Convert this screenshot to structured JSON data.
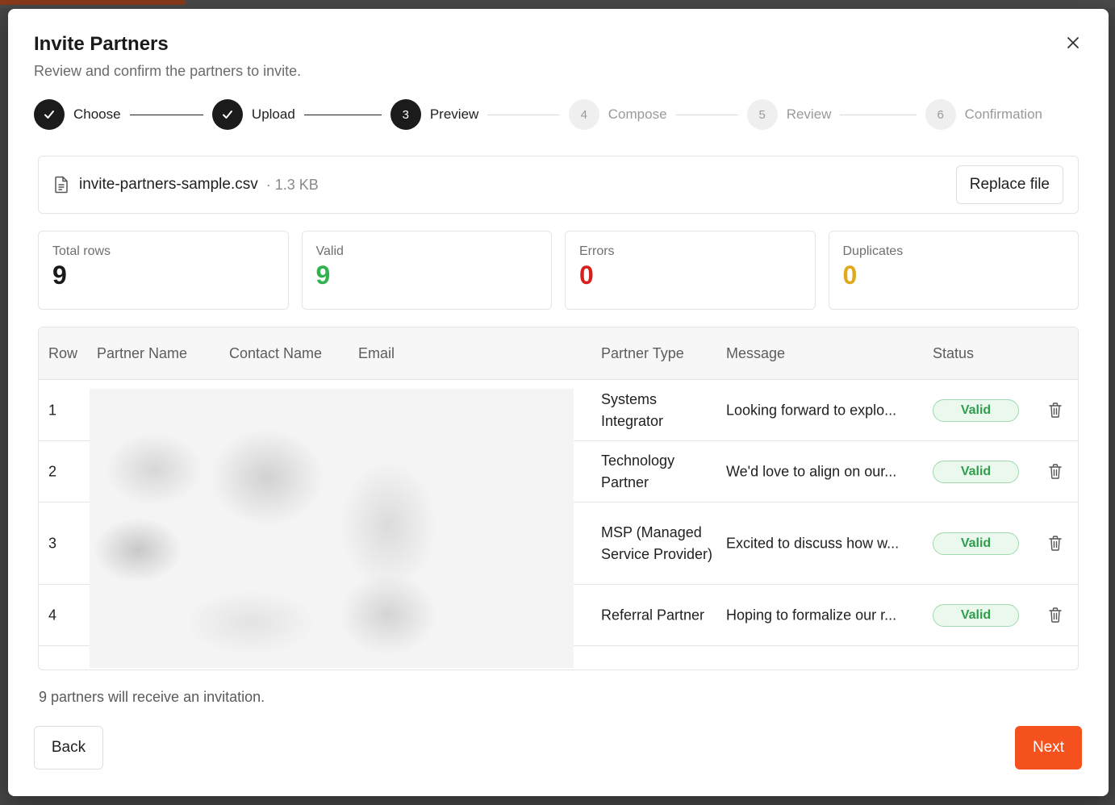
{
  "modal": {
    "title": "Invite Partners",
    "subtitle": "Review and confirm the partners to invite."
  },
  "stepper": [
    {
      "number": "1",
      "label": "Choose",
      "state": "done"
    },
    {
      "number": "2",
      "label": "Upload",
      "state": "done"
    },
    {
      "number": "3",
      "label": "Preview",
      "state": "active"
    },
    {
      "number": "4",
      "label": "Compose",
      "state": "todo"
    },
    {
      "number": "5",
      "label": "Review",
      "state": "todo"
    },
    {
      "number": "6",
      "label": "Confirmation",
      "state": "todo"
    }
  ],
  "file": {
    "name": "invite-partners-sample.csv",
    "size": "· 1.3 KB",
    "replace_label": "Replace file"
  },
  "stats": [
    {
      "label": "Total rows",
      "value": "9",
      "color": "#1a1a1a"
    },
    {
      "label": "Valid",
      "value": "9",
      "color": "#2fb34f"
    },
    {
      "label": "Errors",
      "value": "0",
      "color": "#d62020"
    },
    {
      "label": "Duplicates",
      "value": "0",
      "color": "#e0a91c"
    }
  ],
  "table": {
    "headers": {
      "row": "Row",
      "partner_name": "Partner Name",
      "contact_name": "Contact Name",
      "email": "Email",
      "partner_type": "Partner Type",
      "message": "Message",
      "status": "Status"
    },
    "rows": [
      {
        "row": "1",
        "partner_type": "Systems Integrator",
        "message": "Looking forward to explo...",
        "status": "Valid"
      },
      {
        "row": "2",
        "partner_type": "Technology Partner",
        "message": "We'd love to align on our...",
        "status": "Valid"
      },
      {
        "row": "3",
        "partner_type": "MSP (Managed Service Provider)",
        "message": "Excited to discuss how w...",
        "status": "Valid"
      },
      {
        "row": "4",
        "partner_type": "Referral Partner",
        "message": "Hoping to formalize our r...",
        "status": "Valid"
      }
    ]
  },
  "footer": {
    "note": "9 partners will receive an invitation.",
    "back_label": "Back",
    "next_label": "Next"
  },
  "colors": {
    "accent": "#f4511e",
    "valid_badge": "#2f9e4c"
  },
  "icons": {
    "close": "close-icon",
    "file": "file-icon",
    "trash": "trash-icon",
    "check": "check-icon"
  }
}
